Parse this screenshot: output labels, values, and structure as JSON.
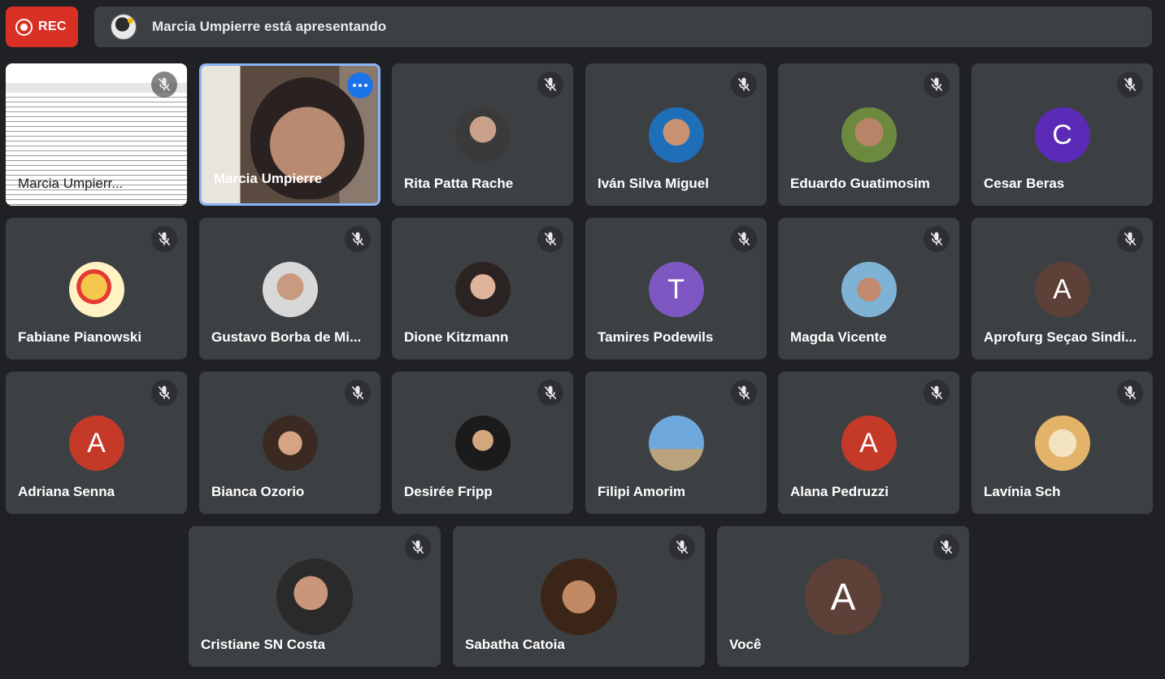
{
  "recording": {
    "label": "REC"
  },
  "presenting_banner": {
    "text": "Marcia Umpierre está apresentando"
  },
  "participants": [
    {
      "name": "Marcia Umpierr...",
      "type": "screen"
    },
    {
      "name": "Marcia Umpierre",
      "type": "video"
    },
    {
      "name": "Rita Patta Rache",
      "type": "photo"
    },
    {
      "name": "Iván Silva Miguel",
      "type": "photo"
    },
    {
      "name": "Eduardo Guatimosim",
      "type": "photo"
    },
    {
      "name": "Cesar Beras",
      "type": "letter",
      "initial": "C",
      "color": "#5b2bb8"
    },
    {
      "name": "Fabiane Pianowski",
      "type": "photo"
    },
    {
      "name": "Gustavo Borba de Mi...",
      "type": "photo"
    },
    {
      "name": "Dione Kitzmann",
      "type": "photo"
    },
    {
      "name": "Tamires Podewils",
      "type": "letter",
      "initial": "T",
      "color": "#7e57c2"
    },
    {
      "name": "Magda Vicente",
      "type": "photo"
    },
    {
      "name": "Aprofurg Seçao Sindi...",
      "type": "letter",
      "initial": "A",
      "color": "#5d4037"
    },
    {
      "name": "Adriana Senna",
      "type": "letter",
      "initial": "A",
      "color": "#c53929"
    },
    {
      "name": "Bianca Ozorio",
      "type": "photo"
    },
    {
      "name": "Desirée Fripp",
      "type": "photo"
    },
    {
      "name": "Filipi Amorim",
      "type": "photo"
    },
    {
      "name": "Alana Pedruzzi",
      "type": "letter",
      "initial": "A",
      "color": "#c53929"
    },
    {
      "name": "Lavínia Sch",
      "type": "photo"
    },
    {
      "name": "Cristiane SN Costa",
      "type": "photo"
    },
    {
      "name": "Sabatha Catoia",
      "type": "photo"
    },
    {
      "name": "Você",
      "type": "letter",
      "initial": "A",
      "color": "#5d4037"
    }
  ],
  "colors": {
    "background": "#202124",
    "tile": "#3c4043",
    "rec": "#d93025",
    "active_border": "#8ab4f8",
    "more_button": "#1a73e8"
  },
  "icons": {
    "mic": "mic-off-icon",
    "more": "more-options-icon",
    "record": "record-icon"
  }
}
